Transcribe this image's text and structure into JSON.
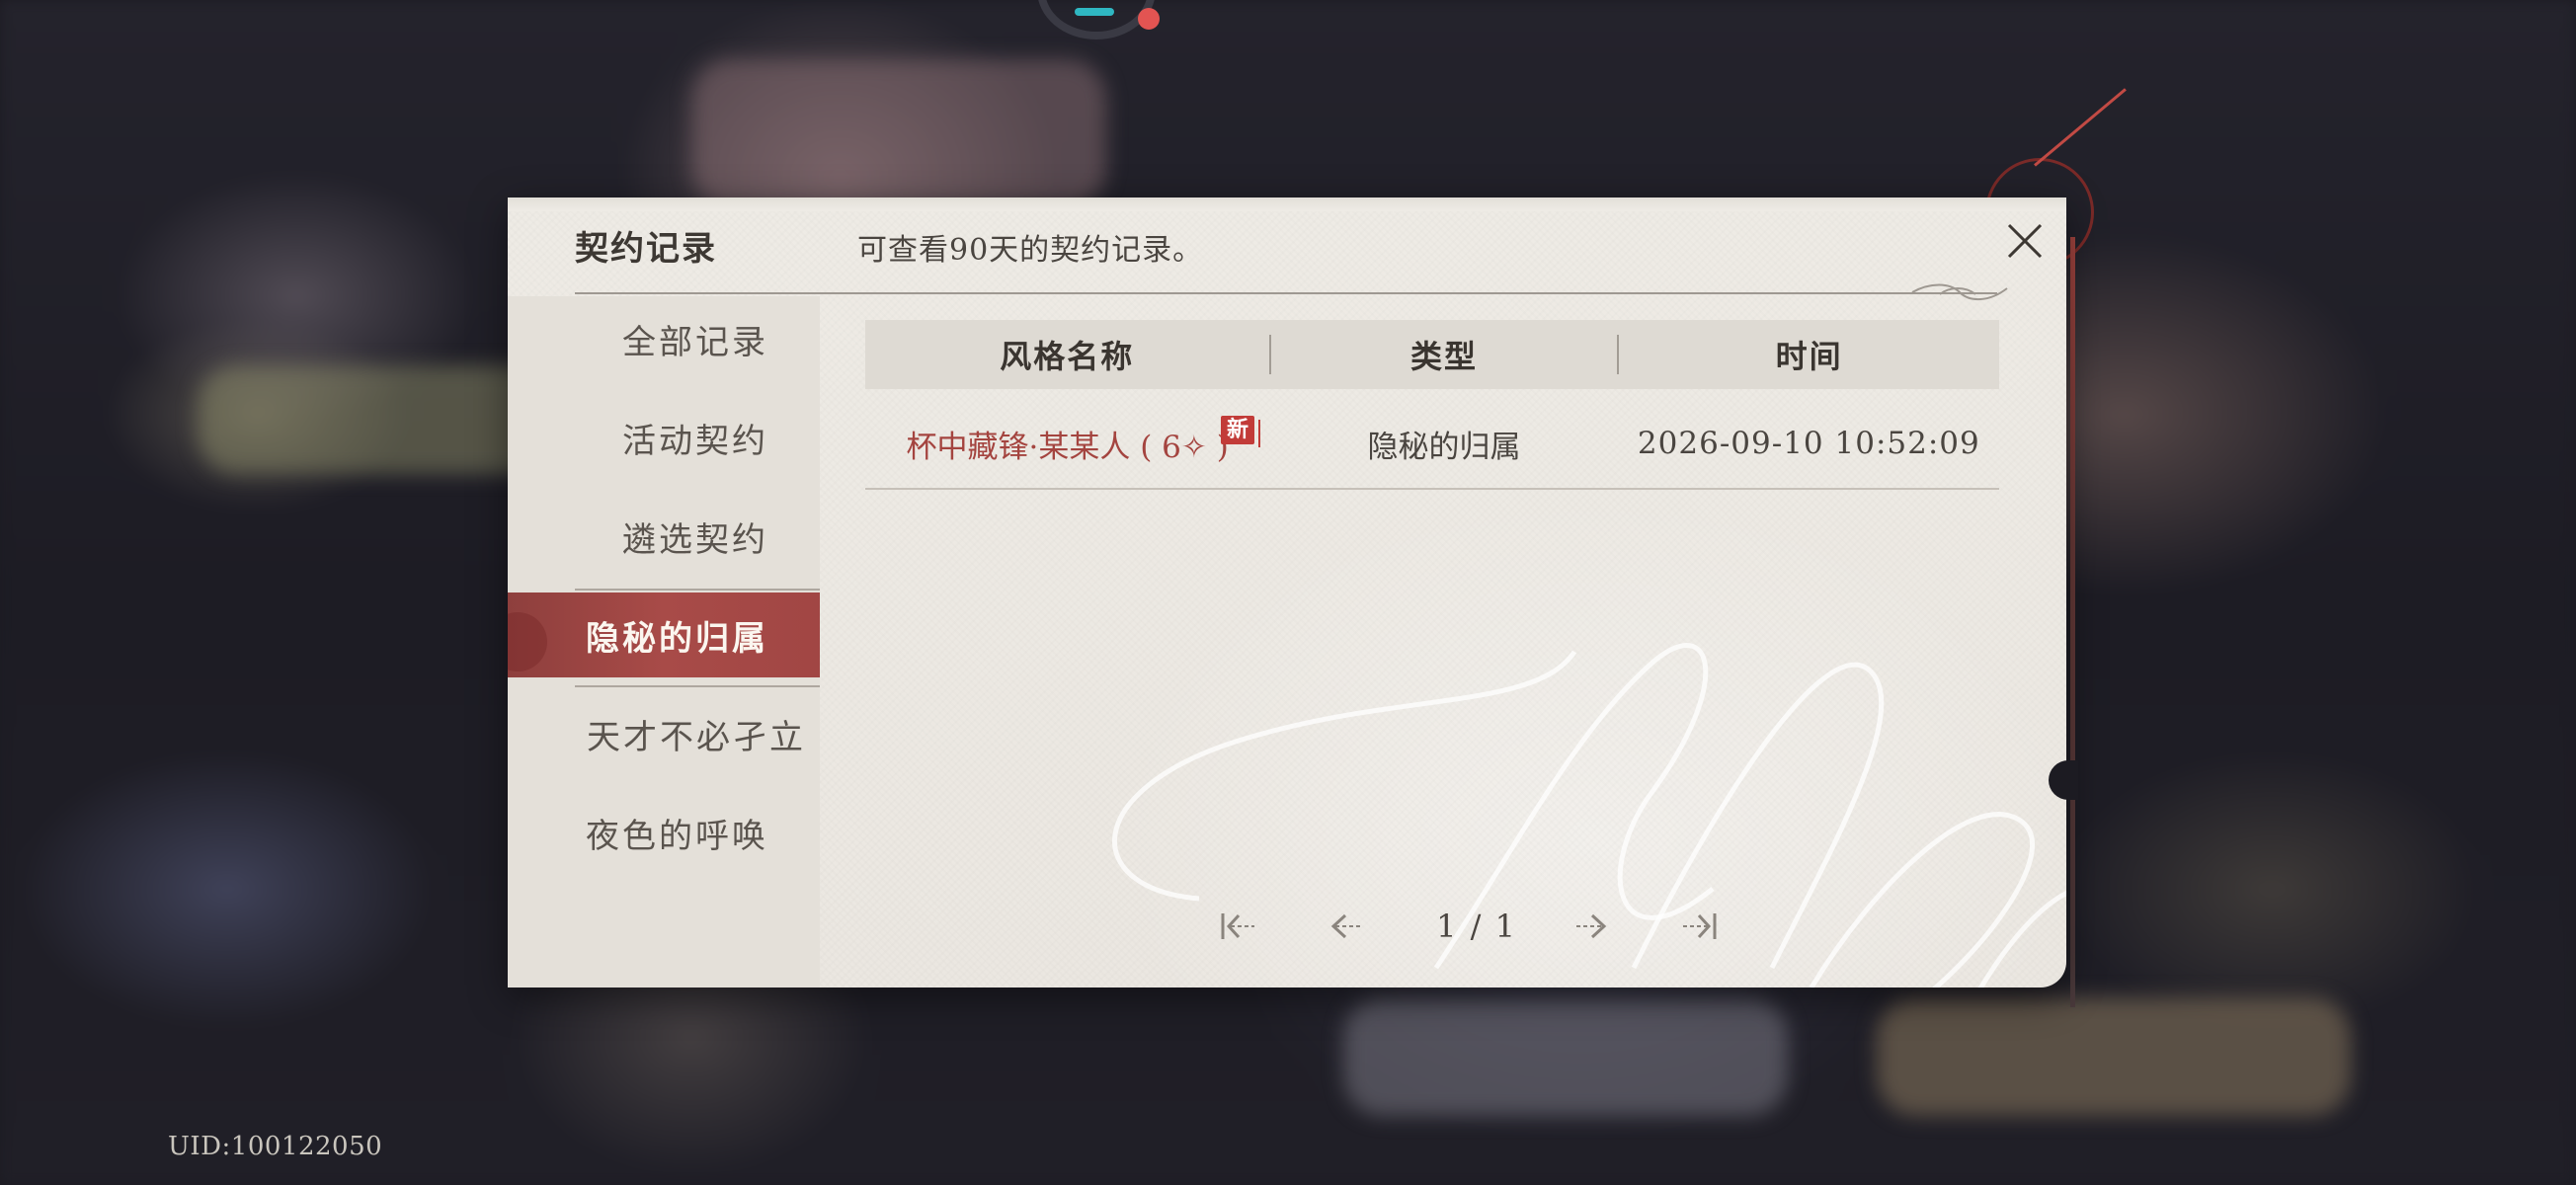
{
  "dialog": {
    "title": "契约记录",
    "subtitle": "可查看90天的契约记录。",
    "close_icon": "close-icon"
  },
  "sidebar": {
    "items": [
      {
        "label": "全部记录",
        "active": false
      },
      {
        "label": "活动契约",
        "active": false
      },
      {
        "label": "遴选契约",
        "active": false
      },
      {
        "label": "隐秘的归属",
        "active": true
      },
      {
        "label": "天才不必孑立",
        "active": false
      },
      {
        "label": "夜色的呼唤",
        "active": false
      }
    ]
  },
  "table": {
    "columns": [
      "风格名称",
      "类型",
      "时间"
    ],
    "rows": [
      {
        "name": "杯中藏锋·某某人 ( 6✧ )",
        "new_badge": "新",
        "type": "隐秘的归属",
        "time": "2026-09-10 10:52:09"
      }
    ]
  },
  "pagination": {
    "text": "1 / 1",
    "first_icon": "first-page-icon",
    "prev_icon": "prev-page-icon",
    "next_icon": "next-page-icon",
    "last_icon": "last-page-icon"
  },
  "footer": {
    "uid": "UID:100122050"
  },
  "colors": {
    "accent_red": "#a84b48",
    "highlight_text": "#a4443f",
    "paper": "#eeebe5",
    "badge_red": "#c23b38"
  }
}
